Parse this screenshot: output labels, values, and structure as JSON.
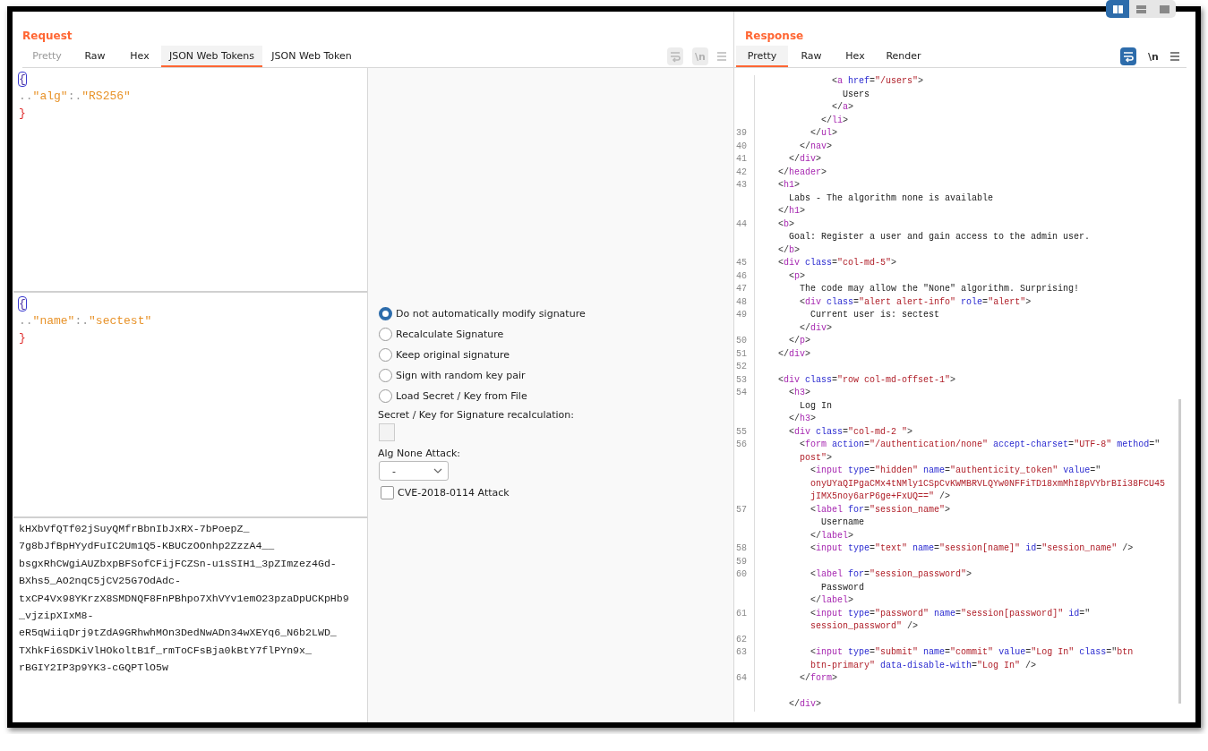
{
  "request": {
    "title": "Request",
    "tabs": [
      {
        "label": "Pretty",
        "selected": false,
        "disabled": true
      },
      {
        "label": "Raw",
        "selected": false,
        "disabled": false
      },
      {
        "label": "Hex",
        "selected": false,
        "disabled": false
      },
      {
        "label": "JSON Web Tokens",
        "selected": true,
        "disabled": false
      },
      {
        "label": "JSON Web Token",
        "selected": false,
        "disabled": false
      }
    ],
    "toolbar": {
      "disabled": true,
      "newline_label": "\\n"
    },
    "header_json": {
      "lines": [
        {
          "kind": "brace",
          "text": "{",
          "highlighted": true
        },
        {
          "kind": "pair",
          "indent": "..",
          "key": "\"alg\"",
          "sep": ":.",
          "value": "\"RS256\""
        },
        {
          "kind": "brace",
          "text": "}",
          "highlighted": false
        }
      ]
    },
    "payload_json": {
      "lines": [
        {
          "kind": "brace",
          "text": "{",
          "highlighted": true
        },
        {
          "kind": "pair",
          "indent": "..",
          "key": "\"name\"",
          "sep": ":.",
          "value": "\"sectest\""
        },
        {
          "kind": "brace",
          "text": "}",
          "highlighted": false
        }
      ]
    },
    "signature": {
      "lines": [
        "kHXbVfQTf02jSuyQMfrBbnIbJxRX-7bPoepZ_",
        "7g8bJfBpHYydFuIC2Um1Q5-KBUCzOOnhp2ZzzA4__",
        "bsgxRhCWgiAUZbxpBFSofCFijFCZSn-u1sSIH1_3pZImzez4Gd-",
        "BXhs5_AO2nqC5jCV25G7OdAdc-",
        "txCP4Vx98YKrzX8SMDNQF8FnPBhpo7XhVYv1emO23pzaDpUCKpHb9",
        "_vjzipXIxM8-",
        "eR5qWiiqDrj9tZdA9GRhwhMOn3DedNwADn34wXEYq6_N6b2LWD_",
        "TXhkFi6SDKiVlHOkoltB1f_rmToCFsBja0kBtY7flPYn9x_",
        "rBGIY2IP3p9YK3-cGQPTlO5w"
      ]
    },
    "options": {
      "radios": [
        {
          "label": "Do not automatically modify signature",
          "selected": true
        },
        {
          "label": "Recalculate Signature",
          "selected": false
        },
        {
          "label": "Keep original signature",
          "selected": false
        },
        {
          "label": "Sign with random key pair",
          "selected": false
        },
        {
          "label": "Load Secret / Key from File",
          "selected": false
        }
      ],
      "secret_label": "Secret / Key for Signature recalculation:",
      "alg_none_label": "Alg None Attack:",
      "alg_none_select": {
        "value": "-"
      },
      "cve_checkbox": {
        "label": "CVE-2018-0114 Attack",
        "checked": false
      }
    }
  },
  "response": {
    "title": "Response",
    "layout_toggles": [
      {
        "kind": "columns",
        "selected": true
      },
      {
        "kind": "rows",
        "selected": false
      },
      {
        "kind": "single",
        "selected": false
      }
    ],
    "tabs": [
      {
        "label": "Pretty",
        "selected": true,
        "disabled": false
      },
      {
        "label": "Raw",
        "selected": false,
        "disabled": false
      },
      {
        "label": "Hex",
        "selected": false,
        "disabled": false
      },
      {
        "label": "Render",
        "selected": false,
        "disabled": false
      }
    ],
    "toolbar": {
      "disabled": false,
      "wrap_on": true,
      "newline_label": "\\n"
    },
    "code_lines": [
      {
        "tokens": [
          {
            "kind": "punct",
            "text": "          <"
          },
          {
            "kind": "tag",
            "text": "a"
          },
          {
            "kind": "attr",
            "text": " href"
          },
          {
            "kind": "punct",
            "text": "="
          },
          {
            "kind": "value",
            "text": "\"/users\""
          },
          {
            "kind": "punct",
            "text": ">"
          }
        ]
      },
      {
        "tokens": [
          {
            "kind": "text",
            "text": "            Users"
          }
        ]
      },
      {
        "tokens": [
          {
            "kind": "punct",
            "text": "          </"
          },
          {
            "kind": "tag",
            "text": "a"
          },
          {
            "kind": "punct",
            "text": ">"
          }
        ]
      },
      {
        "tokens": [
          {
            "kind": "punct",
            "text": "        </"
          },
          {
            "kind": "tag",
            "text": "li"
          },
          {
            "kind": "punct",
            "text": ">"
          }
        ]
      },
      {
        "number": "39",
        "tokens": [
          {
            "kind": "punct",
            "text": "      </"
          },
          {
            "kind": "tag",
            "text": "ul"
          },
          {
            "kind": "punct",
            "text": ">"
          }
        ]
      },
      {
        "number": "40",
        "tokens": [
          {
            "kind": "punct",
            "text": "    </"
          },
          {
            "kind": "tag",
            "text": "nav"
          },
          {
            "kind": "punct",
            "text": ">"
          }
        ]
      },
      {
        "number": "41",
        "tokens": [
          {
            "kind": "punct",
            "text": "  </"
          },
          {
            "kind": "tag",
            "text": "div"
          },
          {
            "kind": "punct",
            "text": ">"
          }
        ]
      },
      {
        "number": "42",
        "tokens": [
          {
            "kind": "punct",
            "text": "</"
          },
          {
            "kind": "tag",
            "text": "header"
          },
          {
            "kind": "punct",
            "text": ">"
          }
        ]
      },
      {
        "number": "43",
        "tokens": [
          {
            "kind": "punct",
            "text": "<"
          },
          {
            "kind": "tag",
            "text": "h1"
          },
          {
            "kind": "punct",
            "text": ">"
          }
        ]
      },
      {
        "tokens": [
          {
            "kind": "text",
            "text": "  Labs - The algorithm none is available"
          }
        ]
      },
      {
        "tokens": [
          {
            "kind": "punct",
            "text": "</"
          },
          {
            "kind": "tag",
            "text": "h1"
          },
          {
            "kind": "punct",
            "text": ">"
          }
        ]
      },
      {
        "number": "44",
        "tokens": [
          {
            "kind": "punct",
            "text": "<"
          },
          {
            "kind": "tag",
            "text": "b"
          },
          {
            "kind": "punct",
            "text": ">"
          }
        ]
      },
      {
        "tokens": [
          {
            "kind": "text",
            "text": "  Goal: Register a user and gain access to the admin user."
          }
        ]
      },
      {
        "tokens": [
          {
            "kind": "punct",
            "text": "</"
          },
          {
            "kind": "tag",
            "text": "b"
          },
          {
            "kind": "punct",
            "text": ">"
          }
        ]
      },
      {
        "number": "45",
        "tokens": [
          {
            "kind": "punct",
            "text": "<"
          },
          {
            "kind": "tag",
            "text": "div"
          },
          {
            "kind": "attr",
            "text": " class"
          },
          {
            "kind": "punct",
            "text": "="
          },
          {
            "kind": "value",
            "text": "\"col-md-5\""
          },
          {
            "kind": "punct",
            "text": ">"
          }
        ]
      },
      {
        "number": "46",
        "tokens": [
          {
            "kind": "punct",
            "text": "  <"
          },
          {
            "kind": "tag",
            "text": "p"
          },
          {
            "kind": "punct",
            "text": ">"
          }
        ]
      },
      {
        "number": "47",
        "tokens": [
          {
            "kind": "text",
            "text": "    The code may allow the \"None\" algorithm. Surprising!"
          }
        ]
      },
      {
        "number": "48",
        "tokens": [
          {
            "kind": "punct",
            "text": "    <"
          },
          {
            "kind": "tag",
            "text": "div"
          },
          {
            "kind": "attr",
            "text": " class"
          },
          {
            "kind": "punct",
            "text": "="
          },
          {
            "kind": "value",
            "text": "\"alert alert-info\""
          },
          {
            "kind": "attr",
            "text": " role"
          },
          {
            "kind": "punct",
            "text": "="
          },
          {
            "kind": "value",
            "text": "\"alert\""
          },
          {
            "kind": "punct",
            "text": ">"
          }
        ]
      },
      {
        "number": "49",
        "tokens": [
          {
            "kind": "text",
            "text": "      Current user is: sectest"
          }
        ]
      },
      {
        "tokens": [
          {
            "kind": "punct",
            "text": "    </"
          },
          {
            "kind": "tag",
            "text": "div"
          },
          {
            "kind": "punct",
            "text": ">"
          }
        ]
      },
      {
        "number": "50",
        "tokens": [
          {
            "kind": "punct",
            "text": "  </"
          },
          {
            "kind": "tag",
            "text": "p"
          },
          {
            "kind": "punct",
            "text": ">"
          }
        ]
      },
      {
        "number": "51",
        "tokens": [
          {
            "kind": "punct",
            "text": "</"
          },
          {
            "kind": "tag",
            "text": "div"
          },
          {
            "kind": "punct",
            "text": ">"
          }
        ]
      },
      {
        "number": "52"
      },
      {
        "number": "53",
        "tokens": [
          {
            "kind": "punct",
            "text": "<"
          },
          {
            "kind": "tag",
            "text": "div"
          },
          {
            "kind": "attr",
            "text": " class"
          },
          {
            "kind": "punct",
            "text": "="
          },
          {
            "kind": "value",
            "text": "\"row col-md-offset-1\""
          },
          {
            "kind": "punct",
            "text": ">"
          }
        ]
      },
      {
        "number": "54",
        "tokens": [
          {
            "kind": "punct",
            "text": "  <"
          },
          {
            "kind": "tag",
            "text": "h3"
          },
          {
            "kind": "punct",
            "text": ">"
          }
        ]
      },
      {
        "tokens": [
          {
            "kind": "text",
            "text": "    Log In"
          }
        ]
      },
      {
        "tokens": [
          {
            "kind": "punct",
            "text": "  </"
          },
          {
            "kind": "tag",
            "text": "h3"
          },
          {
            "kind": "punct",
            "text": ">"
          }
        ]
      },
      {
        "number": "55",
        "tokens": [
          {
            "kind": "punct",
            "text": "  <"
          },
          {
            "kind": "tag",
            "text": "div"
          },
          {
            "kind": "attr",
            "text": " class"
          },
          {
            "kind": "punct",
            "text": "="
          },
          {
            "kind": "value",
            "text": "\"col-md-2 \""
          },
          {
            "kind": "punct",
            "text": ">"
          }
        ]
      },
      {
        "number": "56",
        "tokens": [
          {
            "kind": "punct",
            "text": "    <"
          },
          {
            "kind": "tag",
            "text": "form"
          },
          {
            "kind": "attr",
            "text": " action"
          },
          {
            "kind": "punct",
            "text": "="
          },
          {
            "kind": "value",
            "text": "\"/authentication/none\""
          },
          {
            "kind": "attr",
            "text": " accept-charset"
          },
          {
            "kind": "punct",
            "text": "="
          },
          {
            "kind": "value",
            "text": "\"UTF-8\""
          },
          {
            "kind": "attr",
            "text": " method"
          },
          {
            "kind": "punct",
            "text": "=\""
          }
        ]
      },
      {
        "tokens": [
          {
            "kind": "value",
            "text": "    post\""
          },
          {
            "kind": "punct",
            "text": ">"
          }
        ]
      },
      {
        "tokens": [
          {
            "kind": "punct",
            "text": "      <"
          },
          {
            "kind": "tag",
            "text": "input"
          },
          {
            "kind": "attr",
            "text": " type"
          },
          {
            "kind": "punct",
            "text": "="
          },
          {
            "kind": "value",
            "text": "\"hidden\""
          },
          {
            "kind": "attr",
            "text": " name"
          },
          {
            "kind": "punct",
            "text": "="
          },
          {
            "kind": "value",
            "text": "\"authenticity_token\""
          },
          {
            "kind": "attr",
            "text": " value"
          },
          {
            "kind": "punct",
            "text": "=\""
          }
        ]
      },
      {
        "tokens": [
          {
            "kind": "value",
            "text": "      onyUYaQIPgaCMx4tNMly1CSpCvKWMBRVLQYw0NFFiTD18xmMhI8pVYbrBIi38FCU45"
          }
        ]
      },
      {
        "tokens": [
          {
            "kind": "value",
            "text": "      jIMX5noy6arP6ge+FxUQ==\""
          },
          {
            "kind": "punct",
            "text": " />"
          }
        ]
      },
      {
        "number": "57",
        "tokens": [
          {
            "kind": "punct",
            "text": "      <"
          },
          {
            "kind": "tag",
            "text": "label"
          },
          {
            "kind": "attr",
            "text": " for"
          },
          {
            "kind": "punct",
            "text": "="
          },
          {
            "kind": "value",
            "text": "\"session_name\""
          },
          {
            "kind": "punct",
            "text": ">"
          }
        ]
      },
      {
        "tokens": [
          {
            "kind": "text",
            "text": "        Username"
          }
        ]
      },
      {
        "tokens": [
          {
            "kind": "punct",
            "text": "      </"
          },
          {
            "kind": "tag",
            "text": "label"
          },
          {
            "kind": "punct",
            "text": ">"
          }
        ]
      },
      {
        "number": "58",
        "tokens": [
          {
            "kind": "punct",
            "text": "      <"
          },
          {
            "kind": "tag",
            "text": "input"
          },
          {
            "kind": "attr",
            "text": " type"
          },
          {
            "kind": "punct",
            "text": "="
          },
          {
            "kind": "value",
            "text": "\"text\""
          },
          {
            "kind": "attr",
            "text": " name"
          },
          {
            "kind": "punct",
            "text": "="
          },
          {
            "kind": "value",
            "text": "\"session[name]\""
          },
          {
            "kind": "attr",
            "text": " id"
          },
          {
            "kind": "punct",
            "text": "="
          },
          {
            "kind": "value",
            "text": "\"session_name\""
          },
          {
            "kind": "punct",
            "text": " />"
          }
        ]
      },
      {
        "number": "59"
      },
      {
        "number": "60",
        "tokens": [
          {
            "kind": "punct",
            "text": "      <"
          },
          {
            "kind": "tag",
            "text": "label"
          },
          {
            "kind": "attr",
            "text": " for"
          },
          {
            "kind": "punct",
            "text": "="
          },
          {
            "kind": "value",
            "text": "\"session_password\""
          },
          {
            "kind": "punct",
            "text": ">"
          }
        ]
      },
      {
        "tokens": [
          {
            "kind": "text",
            "text": "        Password"
          }
        ]
      },
      {
        "tokens": [
          {
            "kind": "punct",
            "text": "      </"
          },
          {
            "kind": "tag",
            "text": "label"
          },
          {
            "kind": "punct",
            "text": ">"
          }
        ]
      },
      {
        "number": "61",
        "tokens": [
          {
            "kind": "punct",
            "text": "      <"
          },
          {
            "kind": "tag",
            "text": "input"
          },
          {
            "kind": "attr",
            "text": " type"
          },
          {
            "kind": "punct",
            "text": "="
          },
          {
            "kind": "value",
            "text": "\"password\""
          },
          {
            "kind": "attr",
            "text": " name"
          },
          {
            "kind": "punct",
            "text": "="
          },
          {
            "kind": "value",
            "text": "\"session[password]\""
          },
          {
            "kind": "attr",
            "text": " id"
          },
          {
            "kind": "punct",
            "text": "=\""
          }
        ]
      },
      {
        "tokens": [
          {
            "kind": "value",
            "text": "      session_password\""
          },
          {
            "kind": "punct",
            "text": " />"
          }
        ]
      },
      {
        "number": "62"
      },
      {
        "number": "63",
        "tokens": [
          {
            "kind": "punct",
            "text": "      <"
          },
          {
            "kind": "tag",
            "text": "input"
          },
          {
            "kind": "attr",
            "text": " type"
          },
          {
            "kind": "punct",
            "text": "="
          },
          {
            "kind": "value",
            "text": "\"submit\""
          },
          {
            "kind": "attr",
            "text": " name"
          },
          {
            "kind": "punct",
            "text": "="
          },
          {
            "kind": "value",
            "text": "\"commit\""
          },
          {
            "kind": "attr",
            "text": " value"
          },
          {
            "kind": "punct",
            "text": "="
          },
          {
            "kind": "value",
            "text": "\"Log In\""
          },
          {
            "kind": "attr",
            "text": " class"
          },
          {
            "kind": "punct",
            "text": "=\""
          },
          {
            "kind": "value",
            "text": "btn"
          }
        ]
      },
      {
        "tokens": [
          {
            "kind": "value",
            "text": "      btn-primary\""
          },
          {
            "kind": "attr",
            "text": " data-disable-with"
          },
          {
            "kind": "punct",
            "text": "="
          },
          {
            "kind": "value",
            "text": "\"Log In\""
          },
          {
            "kind": "punct",
            "text": " />"
          }
        ]
      },
      {
        "number": "64",
        "tokens": [
          {
            "kind": "punct",
            "text": "    </"
          },
          {
            "kind": "tag",
            "text": "form"
          },
          {
            "kind": "punct",
            "text": ">"
          }
        ]
      },
      {
        "blank_before": true,
        "tokens": [
          {
            "kind": "punct",
            "text": "  </"
          },
          {
            "kind": "tag",
            "text": "div"
          },
          {
            "kind": "punct",
            "text": ">"
          }
        ]
      }
    ]
  }
}
